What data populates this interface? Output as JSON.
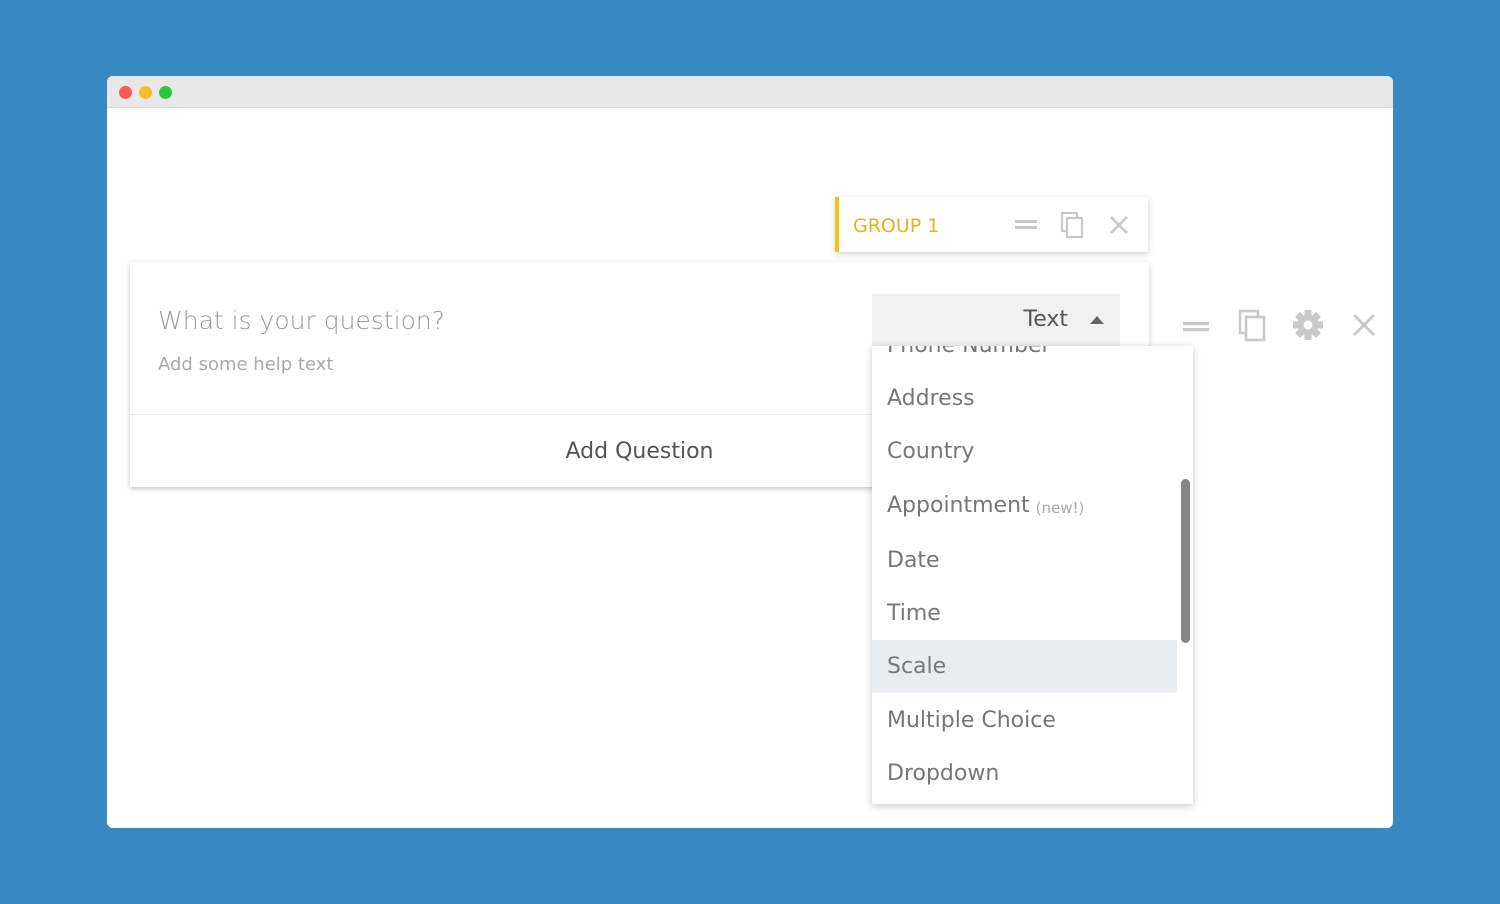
{
  "window": {
    "controls": [
      "close",
      "minimize",
      "maximize"
    ]
  },
  "colors": {
    "background": "#3888c2",
    "group_accent": "#f0c21b",
    "group_label": "#e6b024",
    "icon_gray": "#c8c8c8",
    "active_option": "#e9edf1"
  },
  "group": {
    "label": "GROUP 1",
    "icons": [
      "drag-handle-icon",
      "copy-icon",
      "close-icon"
    ]
  },
  "question": {
    "title_placeholder": "What is your question?",
    "help_placeholder": "Add some help text",
    "type_selected": "Text",
    "add_question_label": "Add Question"
  },
  "dropdown": {
    "options": [
      {
        "label": "Phone Number",
        "badge": ""
      },
      {
        "label": "Address",
        "badge": ""
      },
      {
        "label": "Country",
        "badge": ""
      },
      {
        "label": "Appointment",
        "badge": "(new!)"
      },
      {
        "label": "Date",
        "badge": ""
      },
      {
        "label": "Time",
        "badge": ""
      },
      {
        "label": "Scale",
        "badge": ""
      },
      {
        "label": "Multiple Choice",
        "badge": ""
      },
      {
        "label": "Dropdown",
        "badge": ""
      }
    ],
    "highlighted": "Scale"
  },
  "row_actions": [
    "drag-handle-icon",
    "copy-icon",
    "gear-icon",
    "close-icon"
  ]
}
